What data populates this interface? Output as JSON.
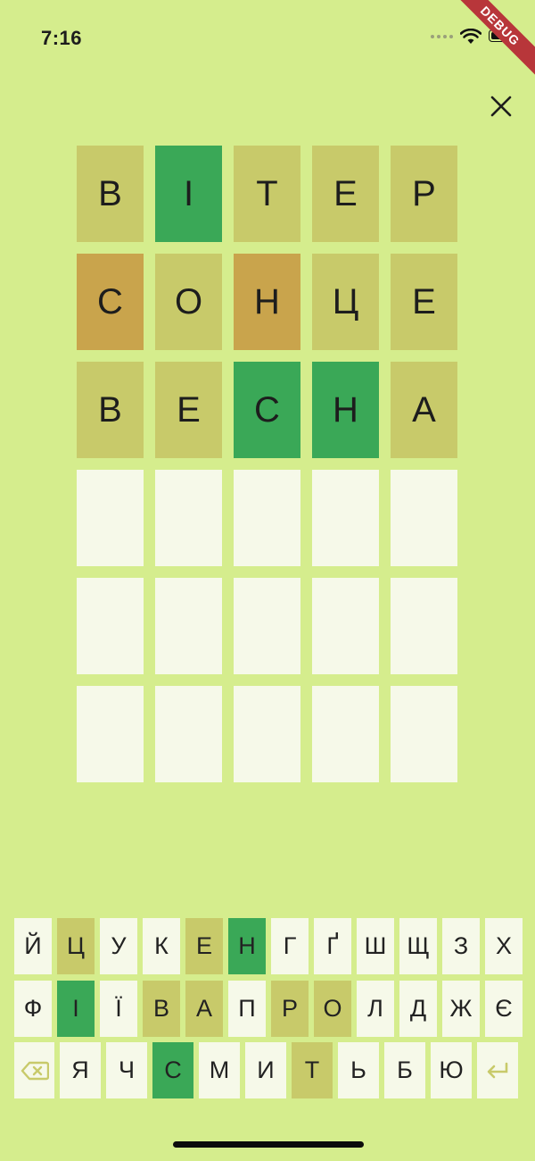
{
  "status_bar": {
    "time": "7:16",
    "debug_label": "DEBUG"
  },
  "board": [
    [
      {
        "letter": "В",
        "state": "absent"
      },
      {
        "letter": "І",
        "state": "correct"
      },
      {
        "letter": "Т",
        "state": "absent"
      },
      {
        "letter": "Е",
        "state": "absent"
      },
      {
        "letter": "Р",
        "state": "absent"
      }
    ],
    [
      {
        "letter": "С",
        "state": "present"
      },
      {
        "letter": "О",
        "state": "absent"
      },
      {
        "letter": "Н",
        "state": "present"
      },
      {
        "letter": "Ц",
        "state": "absent"
      },
      {
        "letter": "Е",
        "state": "absent"
      }
    ],
    [
      {
        "letter": "В",
        "state": "absent"
      },
      {
        "letter": "Е",
        "state": "absent"
      },
      {
        "letter": "С",
        "state": "correct"
      },
      {
        "letter": "Н",
        "state": "correct"
      },
      {
        "letter": "А",
        "state": "absent"
      }
    ],
    [
      {
        "letter": "",
        "state": "empty"
      },
      {
        "letter": "",
        "state": "empty"
      },
      {
        "letter": "",
        "state": "empty"
      },
      {
        "letter": "",
        "state": "empty"
      },
      {
        "letter": "",
        "state": "empty"
      }
    ],
    [
      {
        "letter": "",
        "state": "empty"
      },
      {
        "letter": "",
        "state": "empty"
      },
      {
        "letter": "",
        "state": "empty"
      },
      {
        "letter": "",
        "state": "empty"
      },
      {
        "letter": "",
        "state": "empty"
      }
    ],
    [
      {
        "letter": "",
        "state": "empty"
      },
      {
        "letter": "",
        "state": "empty"
      },
      {
        "letter": "",
        "state": "empty"
      },
      {
        "letter": "",
        "state": "empty"
      },
      {
        "letter": "",
        "state": "empty"
      }
    ]
  ],
  "keyboard": {
    "row1": [
      {
        "label": "Й",
        "state": "empty"
      },
      {
        "label": "Ц",
        "state": "absent"
      },
      {
        "label": "У",
        "state": "empty"
      },
      {
        "label": "К",
        "state": "empty"
      },
      {
        "label": "Е",
        "state": "absent"
      },
      {
        "label": "Н",
        "state": "correct"
      },
      {
        "label": "Г",
        "state": "empty"
      },
      {
        "label": "Ґ",
        "state": "empty"
      },
      {
        "label": "Ш",
        "state": "empty"
      },
      {
        "label": "Щ",
        "state": "empty"
      },
      {
        "label": "З",
        "state": "empty"
      },
      {
        "label": "Х",
        "state": "empty"
      }
    ],
    "row2": [
      {
        "label": "Ф",
        "state": "empty"
      },
      {
        "label": "І",
        "state": "correct"
      },
      {
        "label": "Ї",
        "state": "empty"
      },
      {
        "label": "В",
        "state": "absent"
      },
      {
        "label": "А",
        "state": "absent"
      },
      {
        "label": "П",
        "state": "empty"
      },
      {
        "label": "Р",
        "state": "absent"
      },
      {
        "label": "О",
        "state": "absent"
      },
      {
        "label": "Л",
        "state": "empty"
      },
      {
        "label": "Д",
        "state": "empty"
      },
      {
        "label": "Ж",
        "state": "empty"
      },
      {
        "label": "Є",
        "state": "empty"
      }
    ],
    "row3": [
      {
        "label": "Я",
        "state": "empty"
      },
      {
        "label": "Ч",
        "state": "empty"
      },
      {
        "label": "С",
        "state": "correct"
      },
      {
        "label": "М",
        "state": "empty"
      },
      {
        "label": "И",
        "state": "empty"
      },
      {
        "label": "Т",
        "state": "absent"
      },
      {
        "label": "Ь",
        "state": "empty"
      },
      {
        "label": "Б",
        "state": "empty"
      },
      {
        "label": "Ю",
        "state": "empty"
      }
    ],
    "backspace_icon": "backspace-icon",
    "enter_icon": "enter-icon"
  },
  "colors": {
    "background": "#d5ed8d",
    "empty": "#f6f9e9",
    "absent": "#c8ca6a",
    "present": "#c9a44c",
    "correct": "#3aa857"
  }
}
